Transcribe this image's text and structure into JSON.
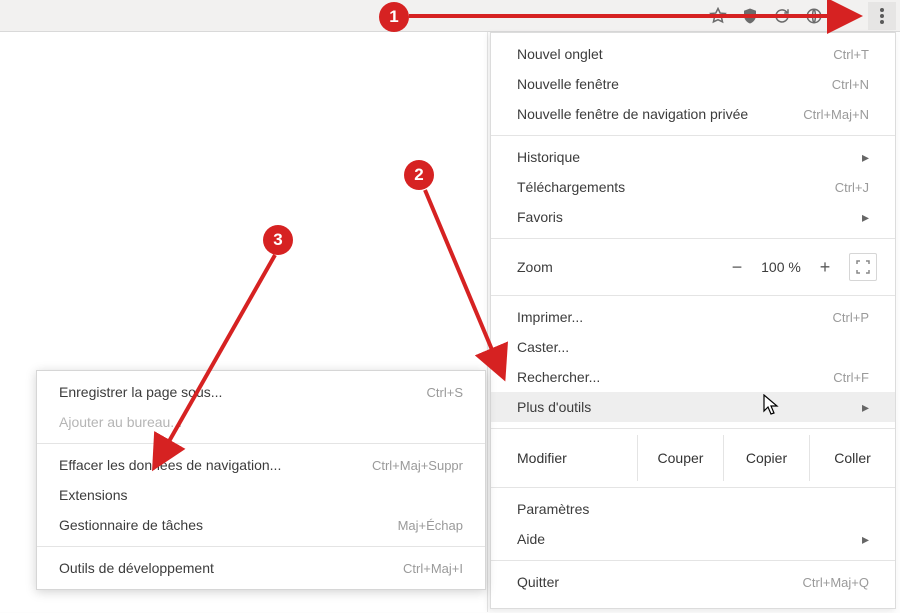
{
  "menu": {
    "new_tab": {
      "label": "Nouvel onglet",
      "shortcut": "Ctrl+T"
    },
    "new_window": {
      "label": "Nouvelle fenêtre",
      "shortcut": "Ctrl+N"
    },
    "incognito": {
      "label": "Nouvelle fenêtre de navigation privée",
      "shortcut": "Ctrl+Maj+N"
    },
    "history": {
      "label": "Historique"
    },
    "downloads": {
      "label": "Téléchargements",
      "shortcut": "Ctrl+J"
    },
    "bookmarks": {
      "label": "Favoris"
    },
    "zoom": {
      "label": "Zoom",
      "value": "100 %"
    },
    "print": {
      "label": "Imprimer...",
      "shortcut": "Ctrl+P"
    },
    "cast": {
      "label": "Caster..."
    },
    "find": {
      "label": "Rechercher...",
      "shortcut": "Ctrl+F"
    },
    "more_tools": {
      "label": "Plus d'outils"
    },
    "edit": {
      "label": "Modifier",
      "cut": "Couper",
      "copy": "Copier",
      "paste": "Coller"
    },
    "settings": {
      "label": "Paramètres"
    },
    "help": {
      "label": "Aide"
    },
    "quit": {
      "label": "Quitter",
      "shortcut": "Ctrl+Maj+Q"
    }
  },
  "submenu": {
    "save_as": {
      "label": "Enregistrer la page sous...",
      "shortcut": "Ctrl+S"
    },
    "add_desktop": {
      "label": "Ajouter au bureau..."
    },
    "clear_data": {
      "label": "Effacer les données de navigation...",
      "shortcut": "Ctrl+Maj+Suppr"
    },
    "extensions": {
      "label": "Extensions"
    },
    "task_manager": {
      "label": "Gestionnaire de tâches",
      "shortcut": "Maj+Échap"
    },
    "dev_tools": {
      "label": "Outils de développement",
      "shortcut": "Ctrl+Maj+I"
    }
  },
  "annotations": {
    "b1": "1",
    "b2": "2",
    "b3": "3"
  },
  "zoom_symbols": {
    "minus": "−",
    "plus": "+"
  }
}
